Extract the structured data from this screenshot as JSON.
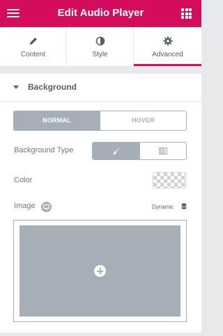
{
  "header": {
    "title": "Edit Audio Player",
    "menu_icon": "hamburger-menu-icon",
    "grid_icon": "widgets-grid-icon",
    "bg_color": "#d30c5c"
  },
  "tabs": [
    {
      "label": "Content",
      "icon": "pencil-icon",
      "active": false
    },
    {
      "label": "Style",
      "icon": "half-circle-contrast-icon",
      "active": false
    },
    {
      "label": "Advanced",
      "icon": "gear-icon",
      "active": true
    }
  ],
  "section": {
    "title": "Background",
    "state_tabs": {
      "normal": "NORMAL",
      "hover": "HOVER",
      "selected": "NORMAL"
    },
    "background_type": {
      "label": "Background Type",
      "options": [
        {
          "icon": "paint-brush-icon",
          "selected": true
        },
        {
          "icon": "gradient-icon",
          "selected": false
        }
      ]
    },
    "color": {
      "label": "Color"
    },
    "image": {
      "label": "Image",
      "responsive_icon": "desktop-monitor-icon",
      "dynamic_label": "Dynamic",
      "dynamic_icon": "database-icon",
      "add_icon": "plus-circle-icon"
    }
  }
}
